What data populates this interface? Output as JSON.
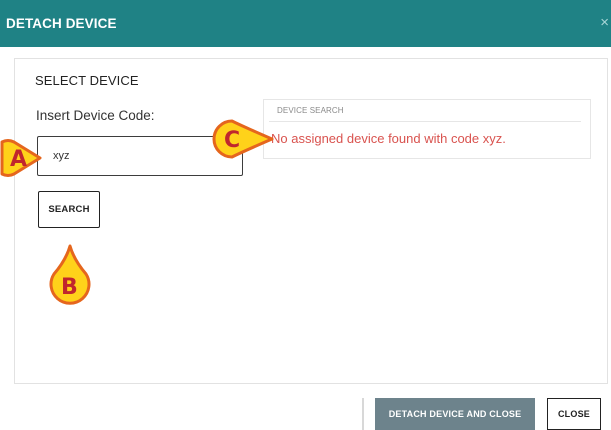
{
  "dialog": {
    "title": "DETACH DEVICE",
    "close_glyph": "×"
  },
  "select_device": {
    "section_title": "SELECT DEVICE",
    "code_label": "Insert Device Code:",
    "code_value": "xyz",
    "search_label": "SEARCH"
  },
  "device_search": {
    "panel_title": "DEVICE SEARCH",
    "result_message": "No assigned device found with code xyz."
  },
  "footer": {
    "detach_close_label": "DETACH DEVICE AND CLOSE",
    "close_label": "CLOSE"
  },
  "callouts": {
    "a": "A",
    "b": "B",
    "c": "C"
  },
  "colors": {
    "header_bg": "#1f8285",
    "error_text": "#d9534f",
    "primary_button": "#6d838c",
    "callout_fill": "#ffd21a",
    "callout_stroke": "#e5661d",
    "callout_letter": "#c0262d"
  }
}
